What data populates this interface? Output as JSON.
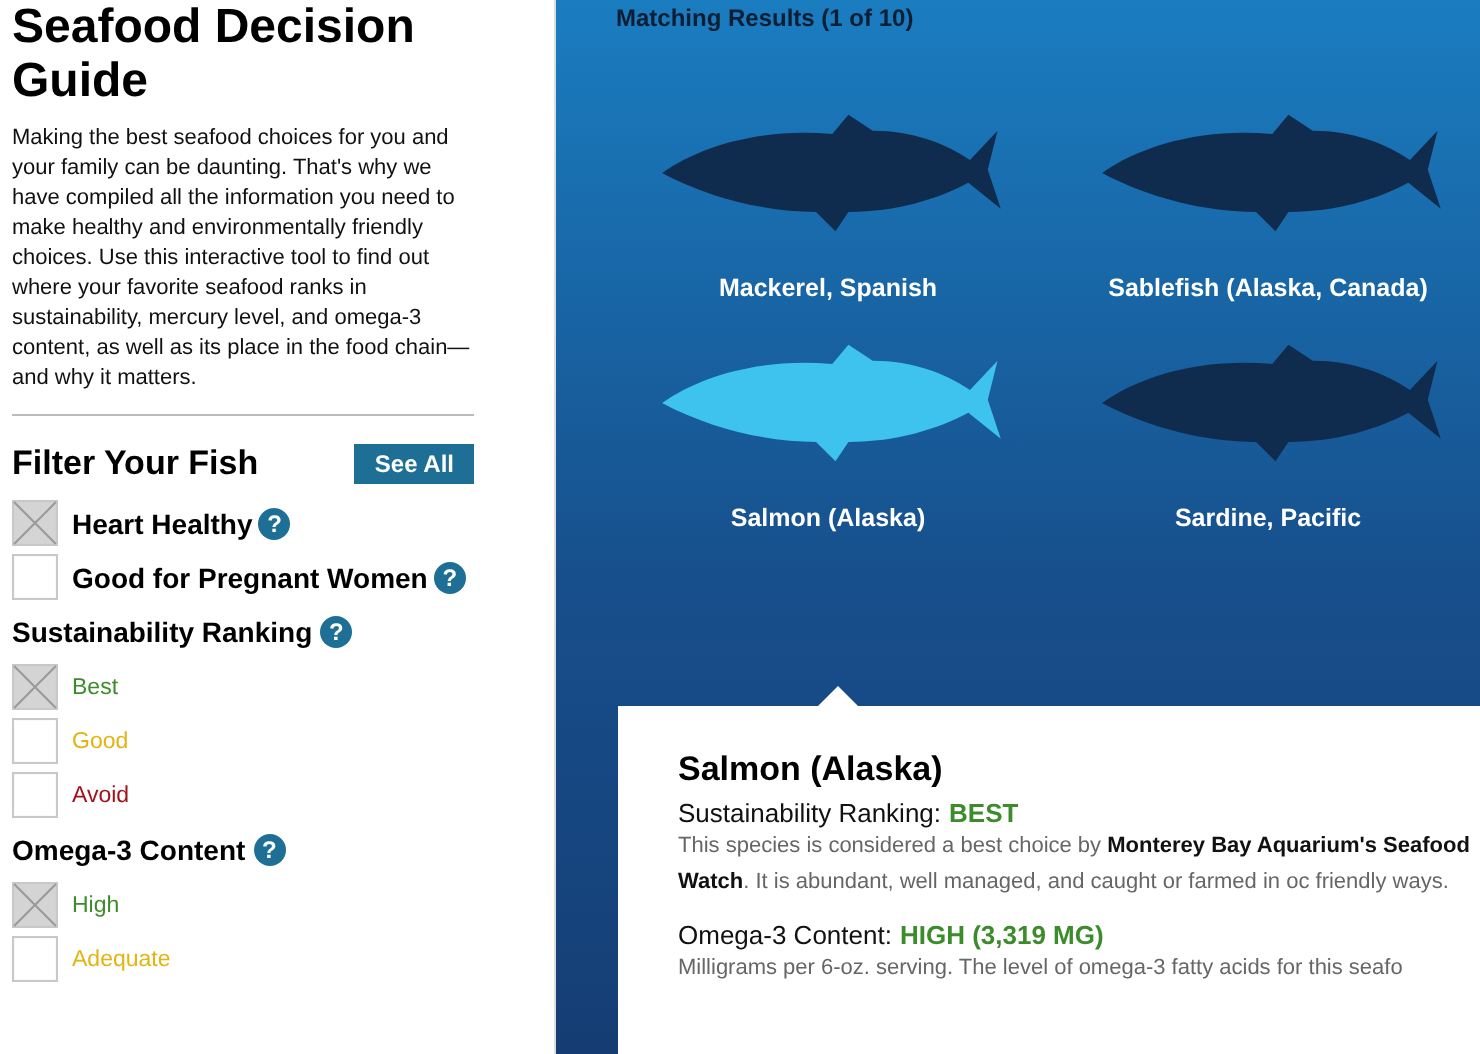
{
  "sidebar": {
    "title": "Seafood Decision Guide",
    "intro": "Making the best seafood choices for you and your family can be daunting. That's why we have compiled all the information you need to make healthy and environmentally friendly choices. Use this interactive tool to find out where your favorite seafood ranks in sustainability, mercury level, and omega-3 content, as well as its place in the food chain—and why it matters.",
    "filter_heading": "Filter Your Fish",
    "see_all": "See All",
    "quick_filters": [
      {
        "label": "Heart Healthy",
        "checked": true,
        "help": "?"
      },
      {
        "label": "Good for Pregnant Women",
        "checked": false,
        "help": "?"
      }
    ],
    "groups": [
      {
        "title": "Sustainability Ranking",
        "help": "?",
        "options": [
          {
            "label": "Best",
            "checked": true,
            "color": "#3c8c2c"
          },
          {
            "label": "Good",
            "checked": false,
            "color": "#e2b512"
          },
          {
            "label": "Avoid",
            "checked": false,
            "color": "#a3121a"
          }
        ]
      },
      {
        "title": "Omega-3 Content",
        "help": "?",
        "options": [
          {
            "label": "High",
            "checked": true,
            "color": "#3c8c2c"
          },
          {
            "label": "Adequate",
            "checked": false,
            "color": "#e2b512"
          }
        ]
      }
    ]
  },
  "results": {
    "heading": "Matching Results (1 of 10)",
    "fish": [
      {
        "name": "Mackerel, Spanish",
        "selected": false
      },
      {
        "name": "Sablefish (Alaska, Canada)",
        "selected": false
      },
      {
        "name": "Salmon (Alaska)",
        "selected": true
      },
      {
        "name": "Sardine, Pacific",
        "selected": false
      }
    ]
  },
  "detail": {
    "name": "Salmon (Alaska)",
    "rows": [
      {
        "label": "Sustainability Ranking:",
        "value": "BEST",
        "description": "This species is considered a best choice by **Monterey Bay Aquarium's Seafood Watch**. It is abundant, well managed, and caught or farmed in oc friendly ways."
      },
      {
        "label": "Omega-3 Content:",
        "value": "HIGH (3,319 MG)",
        "description": "Milligrams per 6-oz. serving. The level of omega-3 fatty acids for this seafo"
      }
    ]
  }
}
